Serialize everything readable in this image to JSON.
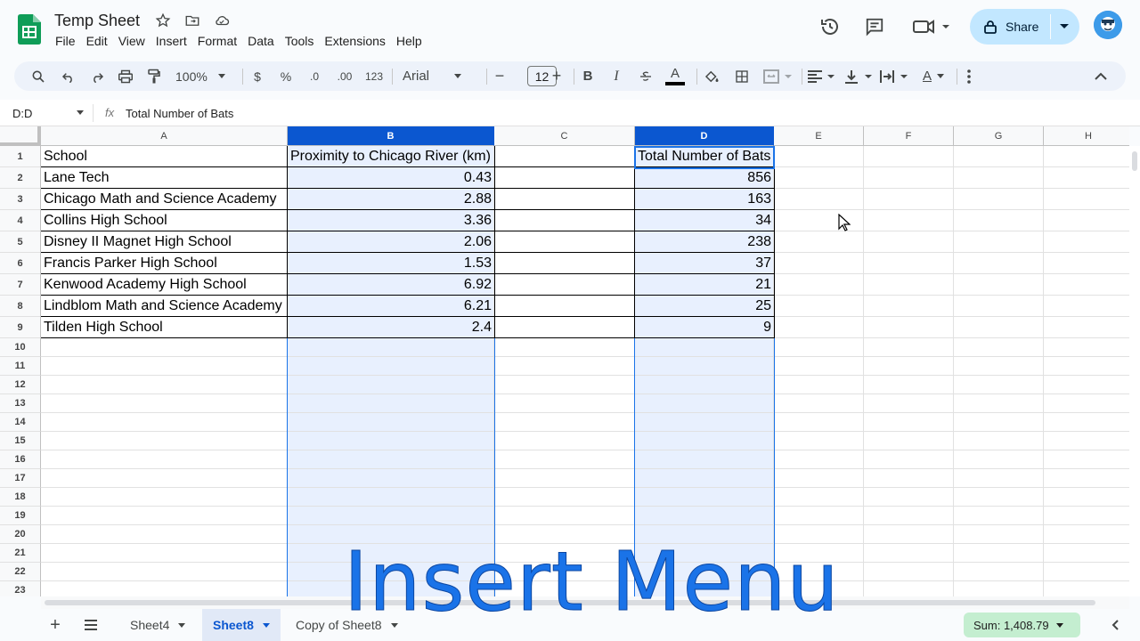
{
  "app": {
    "title": "Temp Sheet",
    "icons": [
      "star-icon",
      "move-to-folder-icon",
      "cloud-saved-icon"
    ]
  },
  "menu": [
    "File",
    "Edit",
    "View",
    "Insert",
    "Format",
    "Data",
    "Tools",
    "Extensions",
    "Help"
  ],
  "header_actions": {
    "share_label": "Share",
    "icons": [
      "history-icon",
      "comment-icon",
      "meet-video-icon",
      "lock-icon",
      "avatar"
    ]
  },
  "toolbar": {
    "zoom": "100%",
    "currency": "$",
    "percent": "%",
    "dec_decrease": ".0",
    "dec_increase": ".00",
    "number_format": "123",
    "font": "Arial",
    "font_size": "12",
    "minus": "−",
    "plus": "+",
    "bold": "B",
    "italic": "I",
    "text_color_letter": "A",
    "text_rotation_letter": "A"
  },
  "formula_bar": {
    "name_box": "D:D",
    "fx": "fx",
    "content": "Total Number of Bats"
  },
  "columns": [
    "A",
    "B",
    "C",
    "D",
    "E",
    "F",
    "G",
    "H"
  ],
  "selected_column": "D",
  "rows": [
    "1",
    "2",
    "3",
    "4",
    "5",
    "6",
    "7",
    "8",
    "9",
    "10",
    "11",
    "12",
    "13",
    "14",
    "15",
    "16",
    "17",
    "18",
    "19",
    "20",
    "21",
    "22",
    "23"
  ],
  "table": {
    "headers": [
      "School",
      "Proximity to Chicago River (km)",
      "",
      "Total Number of Bats"
    ],
    "records": [
      {
        "school": "Lane Tech",
        "proximity": "0.43",
        "bats": "856"
      },
      {
        "school": "Chicago Math and Science Academy",
        "proximity": "2.88",
        "bats": "163"
      },
      {
        "school": "Collins High School",
        "proximity": "3.36",
        "bats": "34"
      },
      {
        "school": "Disney II Magnet High School",
        "proximity": "2.06",
        "bats": "238"
      },
      {
        "school": "Francis Parker High School",
        "proximity": "1.53",
        "bats": "37"
      },
      {
        "school": "Kenwood Academy High School",
        "proximity": "6.92",
        "bats": "21"
      },
      {
        "school": "Lindblom Math and Science Academy",
        "proximity": "6.21",
        "bats": "25"
      },
      {
        "school": "Tilden High School",
        "proximity": "2.4",
        "bats": "9"
      }
    ]
  },
  "sheets": {
    "tabs": [
      "Sheet4",
      "Sheet8",
      "Copy of Sheet8"
    ],
    "active": "Sheet8",
    "add": "+",
    "sum": "Sum: 1,408.79"
  },
  "overlay_caption": "Insert Menu",
  "colors": {
    "accent": "#0b57d0",
    "selection_fill": "#e8f0fe",
    "share_bg": "#c2e7ff",
    "sum_bg": "#c4eed0",
    "caption": "#1a73e8"
  }
}
